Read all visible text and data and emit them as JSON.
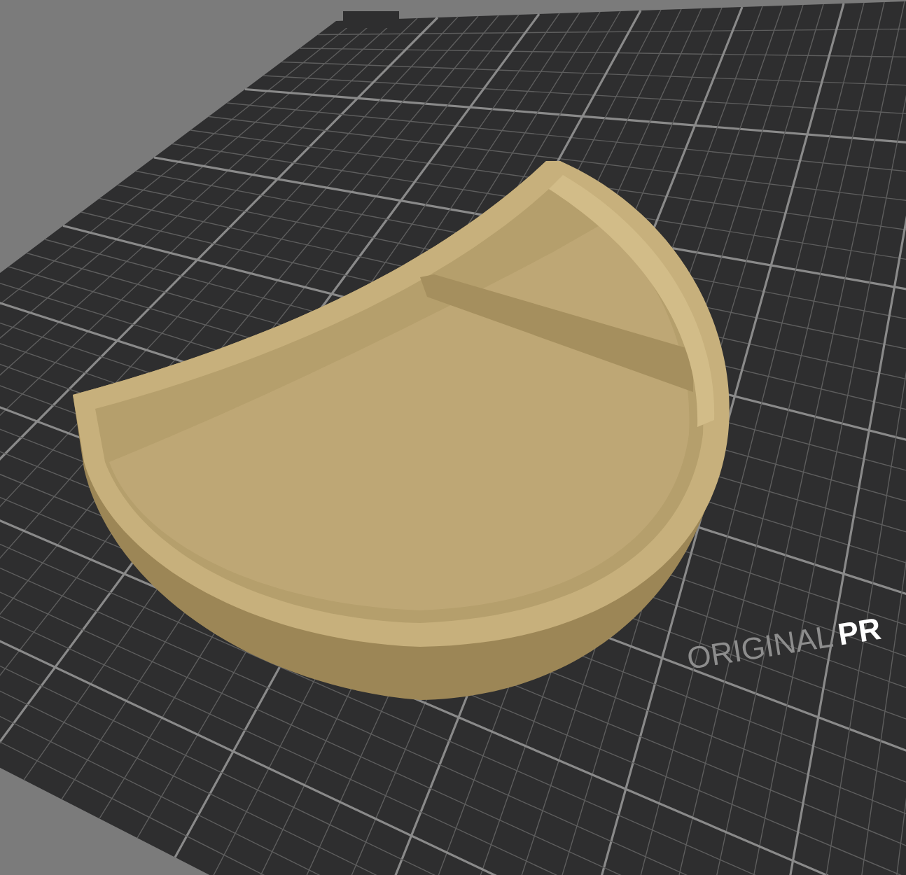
{
  "bed": {
    "label_light": "ORIGINAL",
    "label_bold": "PR"
  }
}
